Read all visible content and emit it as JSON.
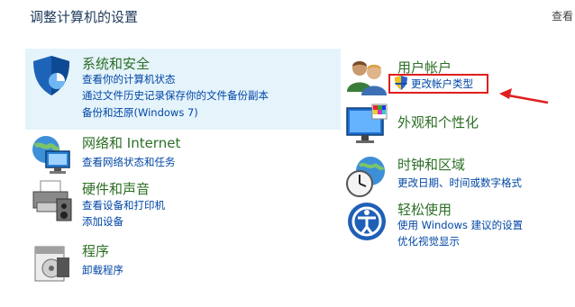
{
  "header": {
    "title": "调整计算机的设置",
    "view_by": "查看"
  },
  "left_categories": [
    {
      "title": "系统和安全",
      "icon": "shield-icon",
      "links": [
        "查看你的计算机状态",
        "通过文件历史记录保存你的文件备份副本",
        "备份和还原(Windows 7)"
      ]
    },
    {
      "title": "网络和 Internet",
      "icon": "network-globe-icon",
      "links": [
        "查看网络状态和任务"
      ]
    },
    {
      "title": "硬件和声音",
      "icon": "printer-icon",
      "links": [
        "查看设备和打印机",
        "添加设备"
      ]
    },
    {
      "title": "程序",
      "icon": "programs-icon",
      "links": [
        "卸载程序"
      ]
    }
  ],
  "right_categories": [
    {
      "title": "用户帐户",
      "icon": "users-icon",
      "links": [
        "更改帐户类型"
      ]
    },
    {
      "title": "外观和个性化",
      "icon": "monitor-palette-icon",
      "links": []
    },
    {
      "title": "时钟和区域",
      "icon": "clock-globe-icon",
      "links": [
        "更改日期、时间或数字格式"
      ]
    },
    {
      "title": "轻松使用",
      "icon": "ease-of-access-icon",
      "links": [
        "使用 Windows 建议的设置",
        "优化视觉显示"
      ]
    }
  ],
  "colors": {
    "heading": "#2c6f25",
    "link": "#0047a5",
    "title": "#1e395b",
    "highlight_box": "#e01e1e",
    "arrow": "#e01e1e",
    "selected_bg": "#e5f3fb"
  }
}
